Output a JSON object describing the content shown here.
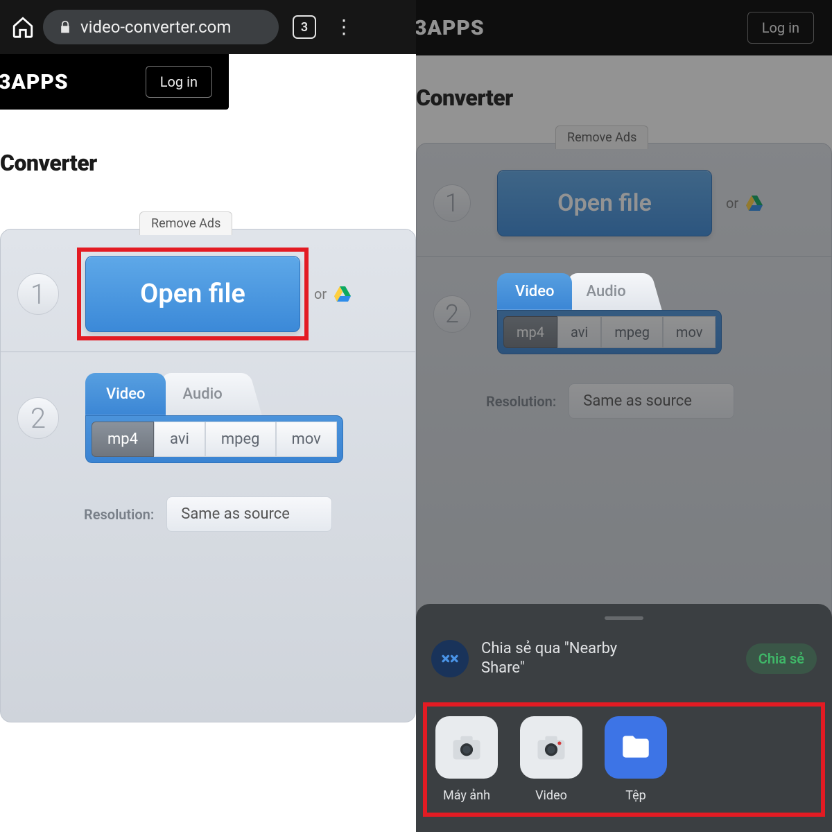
{
  "chrome": {
    "url": "video-converter.com",
    "tab_count": "3"
  },
  "header": {
    "logo": "3APPS",
    "login": "Log in"
  },
  "page": {
    "title_left": "Converter",
    "title_right": "Converter",
    "remove_ads": "Remove Ads"
  },
  "step1": {
    "num": "1",
    "open_file": "Open file",
    "or": "or"
  },
  "step2": {
    "num": "2",
    "tabs": {
      "video": "Video",
      "audio": "Audio"
    },
    "formats": [
      "mp4",
      "avi",
      "mpeg",
      "mov"
    ],
    "res_label": "Resolution:",
    "res_value": "Same as source"
  },
  "sheet": {
    "nearby_line1": "Chia sẻ qua \"Nearby",
    "nearby_line2": "Share\"",
    "share_btn": "Chia sẻ",
    "items": [
      {
        "label": "Máy ảnh"
      },
      {
        "label": "Video"
      },
      {
        "label": "Tệp"
      }
    ]
  }
}
